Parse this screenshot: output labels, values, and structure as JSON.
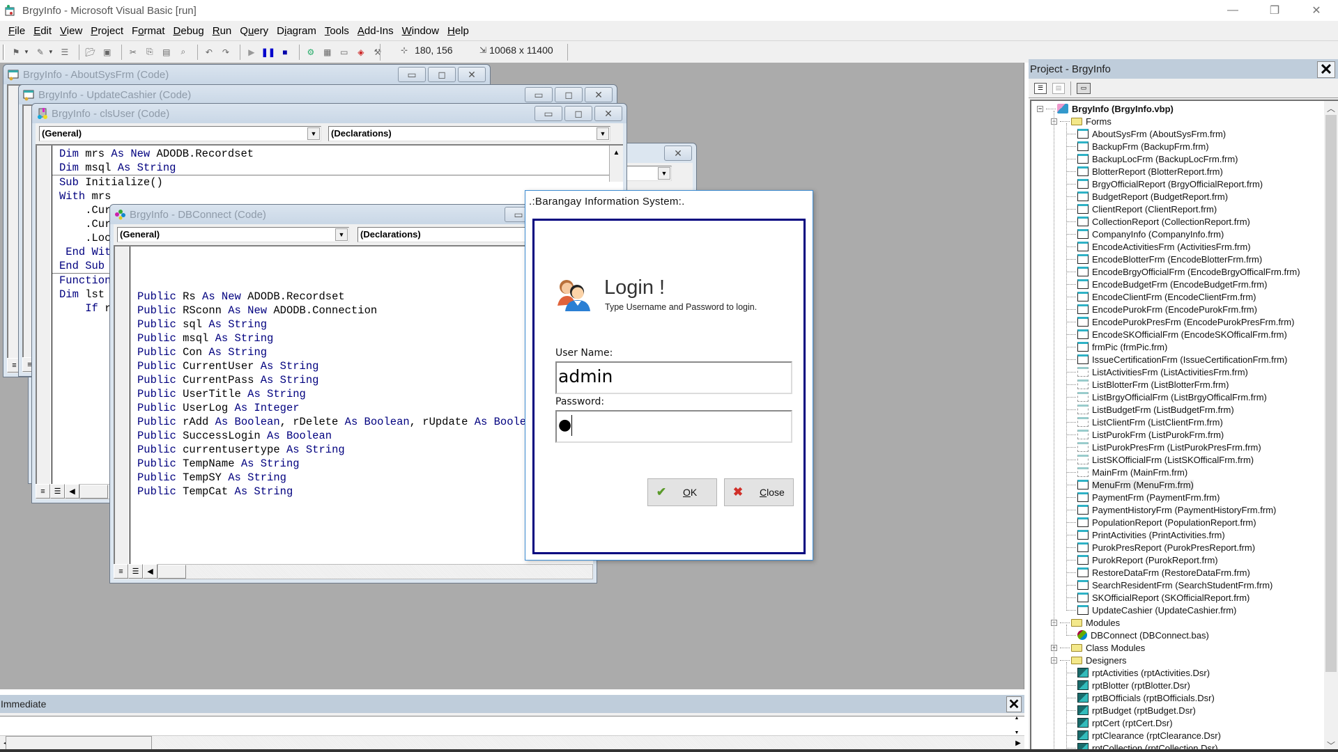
{
  "window": {
    "title": "BrgyInfo - Microsoft Visual Basic [run]",
    "controls": {
      "minimize": "—",
      "restore": "❐",
      "close": "✕"
    }
  },
  "menubar": {
    "items": [
      {
        "label": "File",
        "accel": "F",
        "rest": "ile"
      },
      {
        "label": "Edit",
        "accel": "E",
        "rest": "dit"
      },
      {
        "label": "View",
        "accel": "V",
        "rest": "iew"
      },
      {
        "label": "Project",
        "accel": "P",
        "rest": "roject"
      },
      {
        "label": "Format",
        "pre": "F",
        "accel": "o",
        "rest": "rmat"
      },
      {
        "label": "Debug",
        "accel": "D",
        "rest": "ebug"
      },
      {
        "label": "Run",
        "accel": "R",
        "rest": "un"
      },
      {
        "label": "Query",
        "pre": "Q",
        "accel": "u",
        "rest": "ery"
      },
      {
        "label": "Diagram",
        "pre": "D",
        "accel": "i",
        "rest": "agram"
      },
      {
        "label": "Tools",
        "accel": "T",
        "rest": "ools"
      },
      {
        "label": "Add-Ins",
        "accel": "A",
        "rest": "dd-Ins"
      },
      {
        "label": "Window",
        "accel": "W",
        "rest": "indow"
      },
      {
        "label": "Help",
        "accel": "H",
        "rest": "elp"
      }
    ]
  },
  "toolbar": {
    "position": "180, 156",
    "size": "10068 x 11400",
    "buttons": [
      "add-project",
      "add-form",
      "menu-editor",
      "open-project",
      "save-project",
      "cut",
      "copy",
      "paste",
      "find",
      "undo",
      "redo",
      "start",
      "break",
      "end",
      "project-explorer",
      "properties-window",
      "form-layout",
      "object-browser",
      "toolbox"
    ]
  },
  "code_windows": [
    {
      "title": "BrgyInfo - AboutSysFrm (Code)"
    },
    {
      "title": "BrgyInfo - UpdateCashier (Code)"
    },
    {
      "title": "BrgyInfo - clsUser (Code)",
      "object_combo": "(General)",
      "proc_combo": "(Declarations)",
      "lines": [
        [
          [
            "kw",
            "Dim"
          ],
          [
            "t",
            " mrs "
          ],
          [
            "kw",
            "As New"
          ],
          [
            "t",
            " ADODB.Recordset"
          ]
        ],
        [
          [
            "kw",
            "Dim"
          ],
          [
            "t",
            " msql "
          ],
          [
            "kw",
            "As String"
          ]
        ],
        [
          [
            "sep",
            ""
          ]
        ],
        [
          [
            "kw",
            "Sub"
          ],
          [
            "t",
            " Initialize()"
          ]
        ],
        [
          [
            "kw",
            "With"
          ],
          [
            "t",
            " mrs"
          ]
        ],
        [
          [
            "t",
            "    .CursorLocation"
          ]
        ],
        [
          [
            "t",
            "    .CursorType"
          ]
        ],
        [
          [
            "t",
            "    .LockType"
          ]
        ],
        [
          [
            "kw",
            " End With"
          ]
        ],
        [
          [
            "kw",
            "End Sub"
          ]
        ],
        [
          [
            "sep",
            ""
          ]
        ],
        [
          [
            "kw",
            "Function"
          ]
        ],
        [
          [
            "kw",
            "Dim"
          ],
          [
            "t",
            " lst"
          ]
        ],
        [
          [
            "kw",
            "    If"
          ],
          [
            "t",
            " r"
          ]
        ]
      ]
    },
    {
      "title": "BrgyInfo - DBConnect (Code)",
      "object_combo": "(General)",
      "proc_combo": "(Declarations)",
      "lines": [
        [
          [
            "t",
            ""
          ]
        ],
        [
          [
            "t",
            ""
          ]
        ],
        [
          [
            "t",
            ""
          ]
        ],
        [
          [
            "kw",
            "Public"
          ],
          [
            "t",
            " Rs "
          ],
          [
            "kw",
            "As New"
          ],
          [
            "t",
            " ADODB.Recordset"
          ]
        ],
        [
          [
            "kw",
            "Public"
          ],
          [
            "t",
            " RSconn "
          ],
          [
            "kw",
            "As New"
          ],
          [
            "t",
            " ADODB.Connection"
          ]
        ],
        [
          [
            "kw",
            "Public"
          ],
          [
            "t",
            " sql "
          ],
          [
            "kw",
            "As String"
          ]
        ],
        [
          [
            "kw",
            "Public"
          ],
          [
            "t",
            " msql "
          ],
          [
            "kw",
            "As String"
          ]
        ],
        [
          [
            "kw",
            "Public"
          ],
          [
            "t",
            " Con "
          ],
          [
            "kw",
            "As String"
          ]
        ],
        [
          [
            "kw",
            "Public"
          ],
          [
            "t",
            " CurrentUser "
          ],
          [
            "kw",
            "As String"
          ]
        ],
        [
          [
            "kw",
            "Public"
          ],
          [
            "t",
            " CurrentPass "
          ],
          [
            "kw",
            "As String"
          ]
        ],
        [
          [
            "kw",
            "Public"
          ],
          [
            "t",
            " UserTitle "
          ],
          [
            "kw",
            "As String"
          ]
        ],
        [
          [
            "kw",
            "Public"
          ],
          [
            "t",
            " UserLog "
          ],
          [
            "kw",
            "As Integer"
          ]
        ],
        [
          [
            "kw",
            "Public"
          ],
          [
            "t",
            " rAdd "
          ],
          [
            "kw",
            "As Boolean"
          ],
          [
            "t",
            ", rDelete "
          ],
          [
            "kw",
            "As Boolean"
          ],
          [
            "t",
            ", rUpdate "
          ],
          [
            "kw",
            "As Boolean"
          ]
        ],
        [
          [
            "kw",
            "Public"
          ],
          [
            "t",
            " SuccessLogin "
          ],
          [
            "kw",
            "As Boolean"
          ]
        ],
        [
          [
            "kw",
            "Public"
          ],
          [
            "t",
            " currentusertype "
          ],
          [
            "kw",
            "As String"
          ]
        ],
        [
          [
            "kw",
            "Public"
          ],
          [
            "t",
            " TempName "
          ],
          [
            "kw",
            "As String"
          ]
        ],
        [
          [
            "kw",
            "Public"
          ],
          [
            "t",
            " TempSY "
          ],
          [
            "kw",
            "As String"
          ]
        ],
        [
          [
            "kw",
            "Public"
          ],
          [
            "t",
            " TempCat "
          ],
          [
            "kw",
            "As String"
          ]
        ]
      ]
    },
    {
      "title": "",
      "partial_text": "End"
    }
  ],
  "login_dialog": {
    "title": ".:Barangay Information System:.",
    "heading": "Login !",
    "subheading": "Type Username and Password to login.",
    "username_label": "User Name:",
    "username_value": "admin",
    "password_label": "Password:",
    "password_value": "●",
    "ok_button": {
      "accel": "O",
      "rest": "K"
    },
    "close_button": {
      "accel": "C",
      "rest": "lose"
    },
    "colors": {
      "frame": "#00007f",
      "ok_icon": "#5a9a2a",
      "close_icon": "#d0302a"
    }
  },
  "project_panel": {
    "title": "Project - BrgyInfo",
    "tools": [
      "view-code",
      "view-object",
      "toggle-folders"
    ],
    "root": "BrgyInfo (BrgyInfo.vbp)",
    "folders": [
      {
        "name": "Forms",
        "expanded": true,
        "items": [
          {
            "label": "AboutSysFrm (AboutSysFrm.frm)",
            "type": "form"
          },
          {
            "label": "BackupFrm (BackupFrm.frm)",
            "type": "form"
          },
          {
            "label": "BackupLocFrm (BackupLocFrm.frm)",
            "type": "form"
          },
          {
            "label": "BlotterReport (BlotterReport.frm)",
            "type": "form"
          },
          {
            "label": "BrgyOfficialReport (BrgyOfficialReport.frm)",
            "type": "form"
          },
          {
            "label": "BudgetReport (BudgetReport.frm)",
            "type": "form"
          },
          {
            "label": "ClientReport (ClientReport.frm)",
            "type": "form"
          },
          {
            "label": "CollectionReport (CollectionReport.frm)",
            "type": "form"
          },
          {
            "label": "CompanyInfo (CompanyInfo.frm)",
            "type": "form"
          },
          {
            "label": "EncodeActivitiesFrm (ActivitiesFrm.frm)",
            "type": "form"
          },
          {
            "label": "EncodeBlotterFrm (EncodeBlotterFrm.frm)",
            "type": "form"
          },
          {
            "label": "EncodeBrgyOfficialFrm (EncodeBrgyOfficalFrm.frm)",
            "type": "form"
          },
          {
            "label": "EncodeBudgetFrm (EncodeBudgetFrm.frm)",
            "type": "form"
          },
          {
            "label": "EncodeClientFrm (EncodeClientFrm.frm)",
            "type": "form"
          },
          {
            "label": "EncodePurokFrm (EncodePurokFrm.frm)",
            "type": "form"
          },
          {
            "label": "EncodePurokPresFrm (EncodePurokPresFrm.frm)",
            "type": "form"
          },
          {
            "label": "EncodeSKOfficialFrm (EncodeSKOfficalFrm.frm)",
            "type": "form"
          },
          {
            "label": "frmPic (frmPic.frm)",
            "type": "form"
          },
          {
            "label": "IssueCertificationFrm (IssueCertificationFrm.frm)",
            "type": "form"
          },
          {
            "label": "ListActivitiesFrm (ListActivitiesFrm.frm)",
            "type": "mdichild"
          },
          {
            "label": "ListBlotterFrm (ListBlotterFrm.frm)",
            "type": "mdichild"
          },
          {
            "label": "ListBrgyOfficialFrm (ListBrgyOfficalFrm.frm)",
            "type": "mdichild"
          },
          {
            "label": "ListBudgetFrm (ListBudgetFrm.frm)",
            "type": "mdichild"
          },
          {
            "label": "ListClientFrm (ListClientFrm.frm)",
            "type": "mdichild"
          },
          {
            "label": "ListPurokFrm (ListPurokFrm.frm)",
            "type": "mdichild"
          },
          {
            "label": "ListPurokPresFrm (ListPurokPresFrm.frm)",
            "type": "mdichild"
          },
          {
            "label": "ListSKOfficialFrm (ListSKOfficalFrm.frm)",
            "type": "mdichild"
          },
          {
            "label": "MainFrm (MainFrm.frm)",
            "type": "mdichild"
          },
          {
            "label": "MenuFrm (MenuFrm.frm)",
            "type": "form",
            "selected": true
          },
          {
            "label": "PaymentFrm (PaymentFrm.frm)",
            "type": "form"
          },
          {
            "label": "PaymentHistoryFrm (PaymentHistoryFrm.frm)",
            "type": "form"
          },
          {
            "label": "PopulationReport (PopulationReport.frm)",
            "type": "form"
          },
          {
            "label": "PrintActivities (PrintActivities.frm)",
            "type": "form"
          },
          {
            "label": "PurokPresReport (PurokPresReport.frm)",
            "type": "form"
          },
          {
            "label": "PurokReport (PurokReport.frm)",
            "type": "form"
          },
          {
            "label": "RestoreDataFrm (RestoreDataFrm.frm)",
            "type": "form"
          },
          {
            "label": "SearchResidentFrm (SearchStudentFrm.frm)",
            "type": "form"
          },
          {
            "label": "SKOfficialReport (SKOfficialReport.frm)",
            "type": "form"
          },
          {
            "label": "UpdateCashier (UpdateCashier.frm)",
            "type": "form"
          }
        ]
      },
      {
        "name": "Modules",
        "expanded": true,
        "items": [
          {
            "label": "DBConnect (DBConnect.bas)",
            "type": "module"
          }
        ]
      },
      {
        "name": "Class Modules",
        "expanded": false,
        "items": []
      },
      {
        "name": "Designers",
        "expanded": true,
        "items": [
          {
            "label": "rptActivities (rptActivities.Dsr)",
            "type": "designer"
          },
          {
            "label": "rptBlotter (rptBlotter.Dsr)",
            "type": "designer"
          },
          {
            "label": "rptBOfficials (rptBOfficials.Dsr)",
            "type": "designer"
          },
          {
            "label": "rptBudget (rptBudget.Dsr)",
            "type": "designer"
          },
          {
            "label": "rptCert (rptCert.Dsr)",
            "type": "designer"
          },
          {
            "label": "rptClearance (rptClearance.Dsr)",
            "type": "designer"
          },
          {
            "label": "rptCollection (rptCollection.Dsr)",
            "type": "designer"
          }
        ]
      }
    ]
  },
  "immediate_window": {
    "title": "Immediate",
    "content": ""
  }
}
